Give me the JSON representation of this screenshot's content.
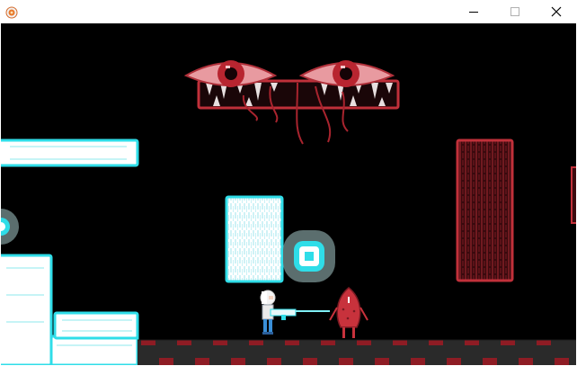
{
  "window": {
    "title": "",
    "icon": "app-orange-icon",
    "controls": [
      {
        "name": "minimize-icon"
      },
      {
        "name": "maximize-icon"
      },
      {
        "name": "close-icon"
      }
    ]
  },
  "colors": {
    "background": "#000000",
    "cyan_platform": "#2fdde8",
    "cyan_fill": "#ffffff",
    "red_frame": "#c0303a",
    "red_dark": "#5a1016",
    "floor_red": "#8e1c24",
    "floor_dark": "#2a2a2a",
    "boss_eye_skin": "#e89aa0",
    "boss_iris": "#b82530",
    "ring_gray": "#5b6e6e"
  },
  "scene": {
    "boss": "floating-eyes-boss",
    "player": "white-haired-gunner",
    "enemy": "red-squid-creature",
    "objects": [
      "cyan-ice-platform",
      "red-crusher-block",
      "cyan-ring-pickup",
      "hazard-floor"
    ]
  }
}
